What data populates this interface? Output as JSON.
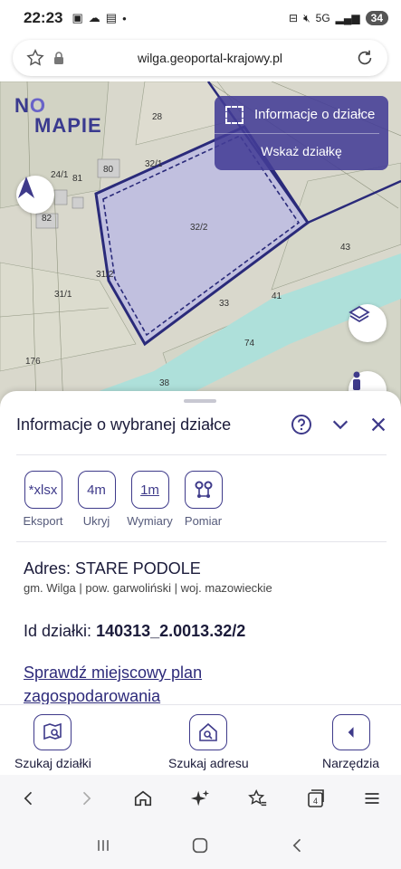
{
  "status": {
    "time": "22:23",
    "battery": "34"
  },
  "browser": {
    "url": "wilga.geoportal-krajowy.pl"
  },
  "map": {
    "logo_prefix": "N",
    "logo_o": "O",
    "logo_rest": "MAPIE",
    "parcel_labels": [
      "28",
      "32/1",
      "24/1",
      "81",
      "80",
      "82",
      "32/2",
      "31/2",
      "31/1",
      "43",
      "41",
      "33",
      "74",
      "176",
      "38"
    ],
    "info_panel": {
      "parcel_info": "Informacje o działce",
      "select_parcel": "Wskaż działkę"
    }
  },
  "sheet": {
    "title": "Informacje o wybranej działce",
    "tools": [
      {
        "icon_text": "*xlsx",
        "label": "Eksport"
      },
      {
        "icon_text": "4m",
        "label": "Ukryj"
      },
      {
        "icon_text": "1m",
        "label": "Wymiary"
      },
      {
        "icon_text": "",
        "label": "Pomiar"
      }
    ],
    "address_title": "Adres: STARE PODOLE",
    "address_sub": "gm. Wilga | pow. garwoliński | woj. mazowieckie",
    "id_label": "Id działki:",
    "id_value": "140313_2.0013.32/2",
    "plan_link": "Sprawdź miejscowy plan zagospodarowania"
  },
  "nav": {
    "search_parcel": "Szukaj działki",
    "search_address": "Szukaj adresu",
    "tools": "Narzędzia"
  },
  "colors": {
    "accent": "#3e3a8a",
    "parcel_fill": "#b8b8e6",
    "river": "#aee0da"
  }
}
